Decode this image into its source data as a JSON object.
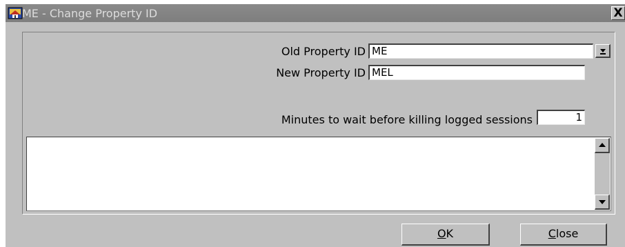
{
  "window": {
    "title": "ME - Change Property  ID",
    "close_glyph": "X",
    "app_icon": "hotel-app-icon"
  },
  "form": {
    "old_property_label": "Old Property ID",
    "old_property_value": "ME",
    "new_property_label": "New Property ID",
    "new_property_value": "MEL",
    "minutes_label": "Minutes to wait before killing logged sessions",
    "minutes_value": "1"
  },
  "output": {
    "text": ""
  },
  "buttons": {
    "ok_mnemonic": "O",
    "ok_rest": "K",
    "close_mnemonic": "C",
    "close_rest": "lose"
  }
}
